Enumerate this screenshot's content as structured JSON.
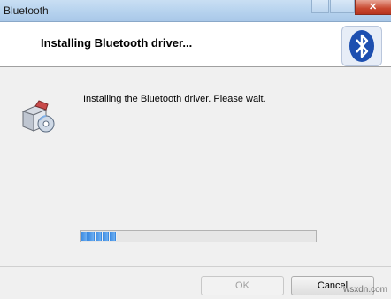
{
  "window": {
    "title": "Bluetooth"
  },
  "header": {
    "heading": "Installing Bluetooth driver..."
  },
  "main": {
    "message": "Installing the Bluetooth driver. Please wait.",
    "progress": {
      "fraction": 0.15
    }
  },
  "footer": {
    "ok_label": "OK",
    "cancel_label": "Cancel"
  },
  "watermark": "wsxdn.com",
  "colors": {
    "accent": "#3c8ae0",
    "logo": "#1d4fb0"
  },
  "icons": [
    "bluetooth-logo-icon",
    "installer-package-icon",
    "close-icon"
  ]
}
